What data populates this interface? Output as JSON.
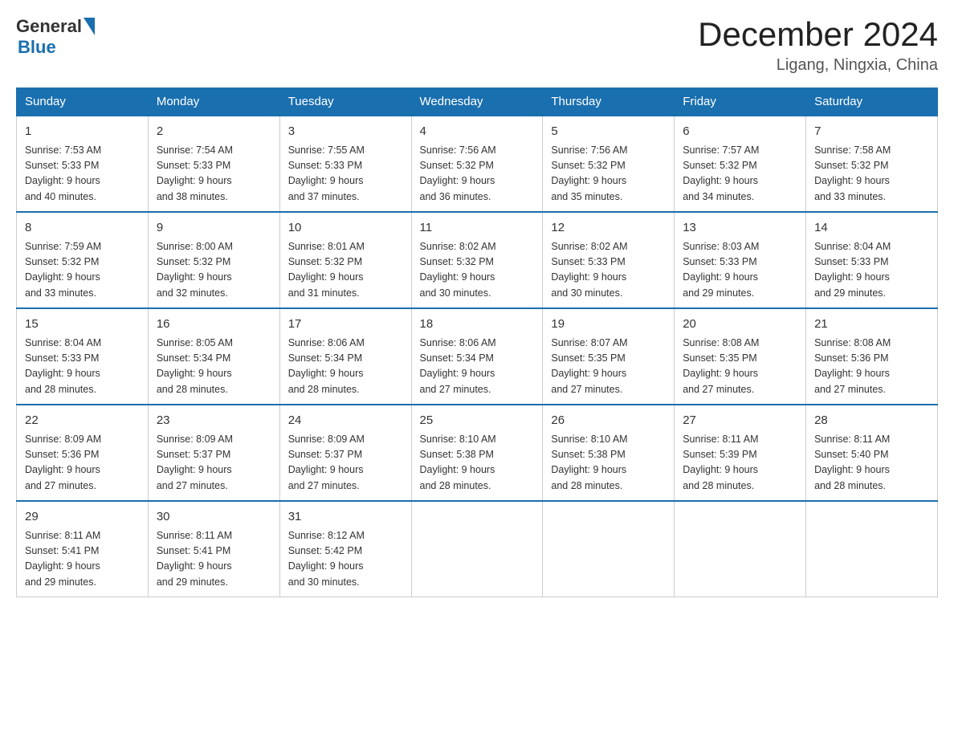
{
  "header": {
    "logo_general": "General",
    "logo_blue": "Blue",
    "main_title": "December 2024",
    "subtitle": "Ligang, Ningxia, China"
  },
  "days_of_week": [
    "Sunday",
    "Monday",
    "Tuesday",
    "Wednesday",
    "Thursday",
    "Friday",
    "Saturday"
  ],
  "weeks": [
    [
      {
        "day": "1",
        "sunrise": "7:53 AM",
        "sunset": "5:33 PM",
        "daylight": "9 hours and 40 minutes."
      },
      {
        "day": "2",
        "sunrise": "7:54 AM",
        "sunset": "5:33 PM",
        "daylight": "9 hours and 38 minutes."
      },
      {
        "day": "3",
        "sunrise": "7:55 AM",
        "sunset": "5:33 PM",
        "daylight": "9 hours and 37 minutes."
      },
      {
        "day": "4",
        "sunrise": "7:56 AM",
        "sunset": "5:32 PM",
        "daylight": "9 hours and 36 minutes."
      },
      {
        "day": "5",
        "sunrise": "7:56 AM",
        "sunset": "5:32 PM",
        "daylight": "9 hours and 35 minutes."
      },
      {
        "day": "6",
        "sunrise": "7:57 AM",
        "sunset": "5:32 PM",
        "daylight": "9 hours and 34 minutes."
      },
      {
        "day": "7",
        "sunrise": "7:58 AM",
        "sunset": "5:32 PM",
        "daylight": "9 hours and 33 minutes."
      }
    ],
    [
      {
        "day": "8",
        "sunrise": "7:59 AM",
        "sunset": "5:32 PM",
        "daylight": "9 hours and 33 minutes."
      },
      {
        "day": "9",
        "sunrise": "8:00 AM",
        "sunset": "5:32 PM",
        "daylight": "9 hours and 32 minutes."
      },
      {
        "day": "10",
        "sunrise": "8:01 AM",
        "sunset": "5:32 PM",
        "daylight": "9 hours and 31 minutes."
      },
      {
        "day": "11",
        "sunrise": "8:02 AM",
        "sunset": "5:32 PM",
        "daylight": "9 hours and 30 minutes."
      },
      {
        "day": "12",
        "sunrise": "8:02 AM",
        "sunset": "5:33 PM",
        "daylight": "9 hours and 30 minutes."
      },
      {
        "day": "13",
        "sunrise": "8:03 AM",
        "sunset": "5:33 PM",
        "daylight": "9 hours and 29 minutes."
      },
      {
        "day": "14",
        "sunrise": "8:04 AM",
        "sunset": "5:33 PM",
        "daylight": "9 hours and 29 minutes."
      }
    ],
    [
      {
        "day": "15",
        "sunrise": "8:04 AM",
        "sunset": "5:33 PM",
        "daylight": "9 hours and 28 minutes."
      },
      {
        "day": "16",
        "sunrise": "8:05 AM",
        "sunset": "5:34 PM",
        "daylight": "9 hours and 28 minutes."
      },
      {
        "day": "17",
        "sunrise": "8:06 AM",
        "sunset": "5:34 PM",
        "daylight": "9 hours and 28 minutes."
      },
      {
        "day": "18",
        "sunrise": "8:06 AM",
        "sunset": "5:34 PM",
        "daylight": "9 hours and 27 minutes."
      },
      {
        "day": "19",
        "sunrise": "8:07 AM",
        "sunset": "5:35 PM",
        "daylight": "9 hours and 27 minutes."
      },
      {
        "day": "20",
        "sunrise": "8:08 AM",
        "sunset": "5:35 PM",
        "daylight": "9 hours and 27 minutes."
      },
      {
        "day": "21",
        "sunrise": "8:08 AM",
        "sunset": "5:36 PM",
        "daylight": "9 hours and 27 minutes."
      }
    ],
    [
      {
        "day": "22",
        "sunrise": "8:09 AM",
        "sunset": "5:36 PM",
        "daylight": "9 hours and 27 minutes."
      },
      {
        "day": "23",
        "sunrise": "8:09 AM",
        "sunset": "5:37 PM",
        "daylight": "9 hours and 27 minutes."
      },
      {
        "day": "24",
        "sunrise": "8:09 AM",
        "sunset": "5:37 PM",
        "daylight": "9 hours and 27 minutes."
      },
      {
        "day": "25",
        "sunrise": "8:10 AM",
        "sunset": "5:38 PM",
        "daylight": "9 hours and 28 minutes."
      },
      {
        "day": "26",
        "sunrise": "8:10 AM",
        "sunset": "5:38 PM",
        "daylight": "9 hours and 28 minutes."
      },
      {
        "day": "27",
        "sunrise": "8:11 AM",
        "sunset": "5:39 PM",
        "daylight": "9 hours and 28 minutes."
      },
      {
        "day": "28",
        "sunrise": "8:11 AM",
        "sunset": "5:40 PM",
        "daylight": "9 hours and 28 minutes."
      }
    ],
    [
      {
        "day": "29",
        "sunrise": "8:11 AM",
        "sunset": "5:41 PM",
        "daylight": "9 hours and 29 minutes."
      },
      {
        "day": "30",
        "sunrise": "8:11 AM",
        "sunset": "5:41 PM",
        "daylight": "9 hours and 29 minutes."
      },
      {
        "day": "31",
        "sunrise": "8:12 AM",
        "sunset": "5:42 PM",
        "daylight": "9 hours and 30 minutes."
      },
      {
        "day": "",
        "sunrise": "",
        "sunset": "",
        "daylight": ""
      },
      {
        "day": "",
        "sunrise": "",
        "sunset": "",
        "daylight": ""
      },
      {
        "day": "",
        "sunrise": "",
        "sunset": "",
        "daylight": ""
      },
      {
        "day": "",
        "sunrise": "",
        "sunset": "",
        "daylight": ""
      }
    ]
  ],
  "labels": {
    "sunrise": "Sunrise:",
    "sunset": "Sunset:",
    "daylight": "Daylight:"
  }
}
